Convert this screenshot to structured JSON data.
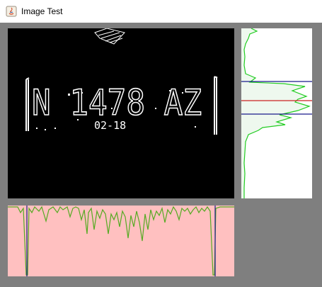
{
  "window": {
    "title": "Image Test",
    "icon": "java-app-icon"
  },
  "edge_image": {
    "plate_text": "N 1478 AZ",
    "plate_subtext": "02-18",
    "background": "#000000",
    "foreground": "#ffffff"
  },
  "row_projection": {
    "background": "#ffffff",
    "curve_color": "#22cc22",
    "fill_color": "#eef8ee",
    "top_bound_color": "#1a1a8c",
    "center_color": "#cc2222",
    "bottom_bound_color": "#1a1a8c"
  },
  "column_projection": {
    "background": "#ffc0c0",
    "curve_color": "#55aa22",
    "bound_color": "#1a1a8c"
  }
}
